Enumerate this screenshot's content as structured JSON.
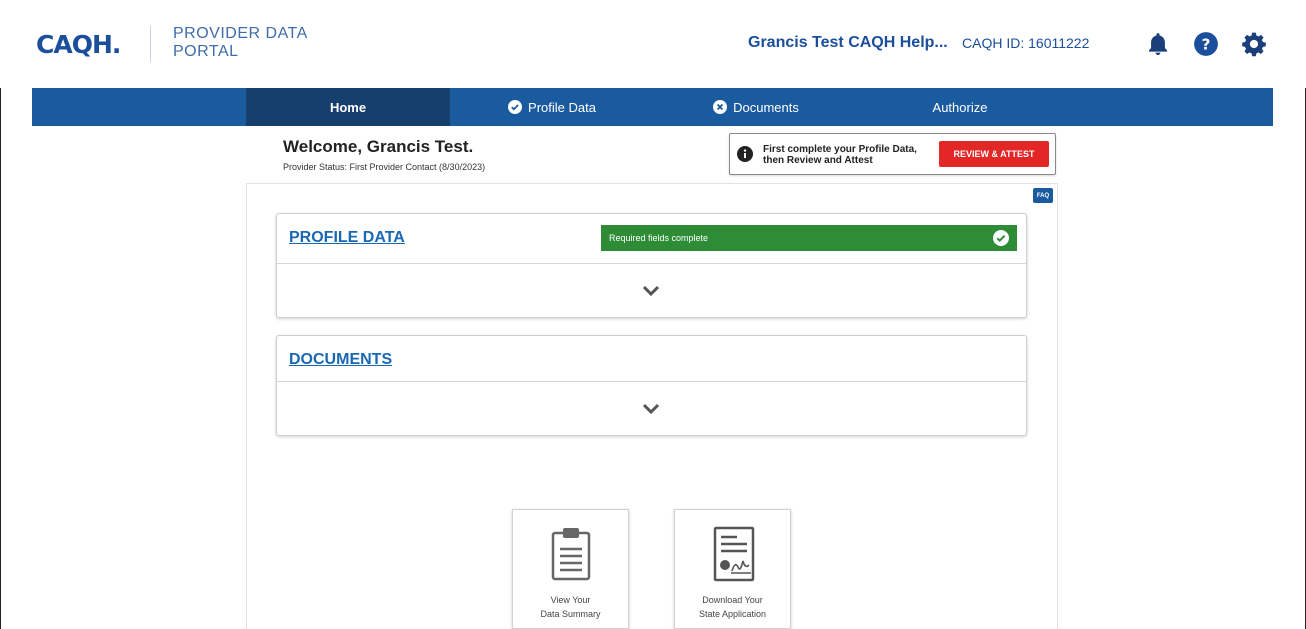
{
  "header": {
    "logo": "CAQH.",
    "portal_title_line1": "PROVIDER DATA",
    "portal_title_line2": "PORTAL",
    "user_name": "Grancis Test CAQH Help...",
    "caqh_id": "CAQH ID: 16011222",
    "icons": [
      "bell-icon",
      "help-icon",
      "gear-icon"
    ]
  },
  "nav": {
    "items": [
      {
        "label": "Home",
        "icon": "",
        "active": true
      },
      {
        "label": "Profile Data",
        "icon": "check-circle-icon",
        "active": false
      },
      {
        "label": "Documents",
        "icon": "x-circle-icon",
        "active": false
      },
      {
        "label": "Authorize",
        "icon": "",
        "active": false
      }
    ]
  },
  "welcome": {
    "heading": "Welcome, Grancis Test.",
    "status": "Provider Status: First Provider Contact (8/30/2023)"
  },
  "attest": {
    "message_line1": "First complete your Profile Data,",
    "message_line2": "then Review and Attest",
    "button_label": "REVIEW & ATTEST"
  },
  "faq_label": "FAQ",
  "panels": {
    "profile": {
      "title": "PROFILE DATA",
      "status": "Required fields complete"
    },
    "documents": {
      "title": "DOCUMENTS"
    }
  },
  "tiles": [
    {
      "line1": "View Your",
      "line2": "Data Summary",
      "icon": "clipboard-icon"
    },
    {
      "line1": "Download Your",
      "line2": "State Application",
      "icon": "certificate-icon"
    }
  ],
  "colors": {
    "brand_blue": "#1b4e9b",
    "nav_blue": "#1a5a9f",
    "nav_active": "#163f6e",
    "attest_red": "#e32626",
    "success_green": "#2e8c36"
  }
}
